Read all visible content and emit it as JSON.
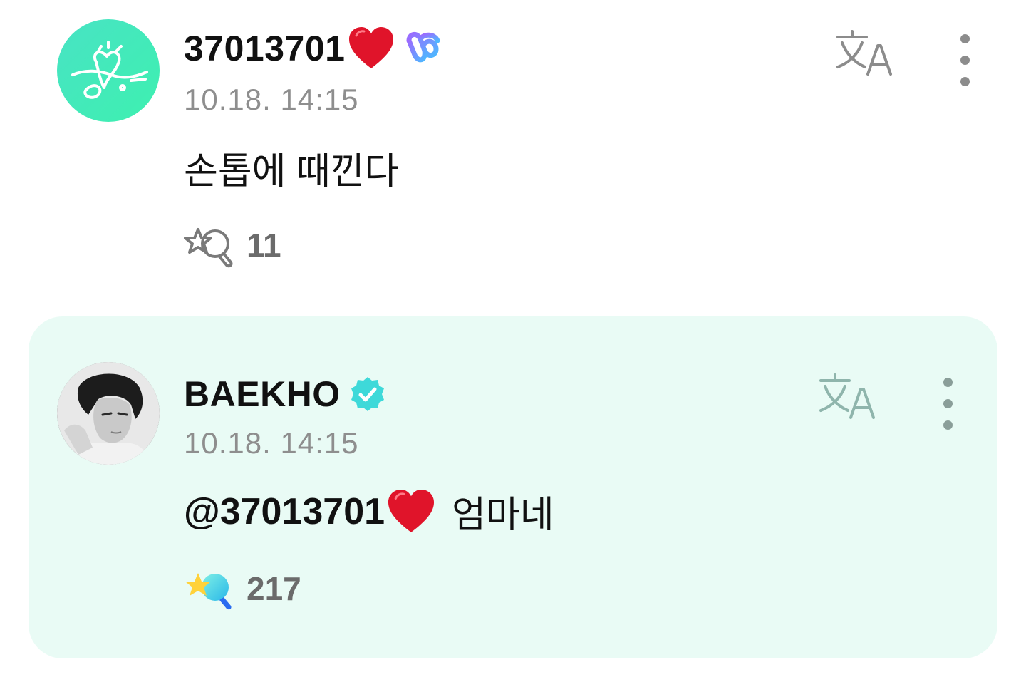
{
  "comment": {
    "username": "37013701",
    "timestamp": "10.18. 14:15",
    "text": "손톱에 때낀다",
    "reaction_count": "11",
    "avatar_icon": "fan-logo-icon",
    "badge_icon": "fanclub-badge-icon"
  },
  "reply": {
    "username": "BAEKHO",
    "timestamp": "10.18. 14:15",
    "mention": "@37013701",
    "text": "엄마네",
    "reaction_count": "217",
    "verified_icon": "verified-badge-icon"
  },
  "colors": {
    "reply_background": "#e9fbf5",
    "avatar_teal": "#3ee6b8",
    "verified": "#3ed9d9",
    "heart": "#e0142a"
  }
}
